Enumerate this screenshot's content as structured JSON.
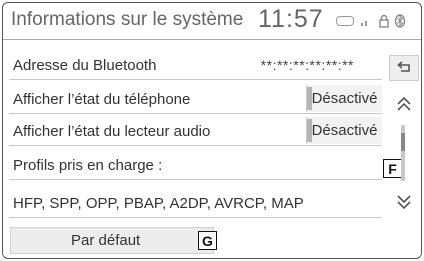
{
  "header": {
    "title": "Informations sur le système",
    "clock": "11:57",
    "status_icons": [
      "dcm-icon",
      "signal-icon",
      "lock-icon",
      "bluetooth-icon"
    ]
  },
  "rows": [
    {
      "label": "Adresse du Bluetooth",
      "value": "**:**:**:**:**:**"
    },
    {
      "label": "Afficher l’état du téléphone",
      "toggle": "Désactivé"
    },
    {
      "label": "Afficher l’état du lecteur audio",
      "toggle": "Désactivé"
    },
    {
      "label": "Profils pris en charge :"
    },
    {
      "label": "HFP, SPP, OPP, PBAP, A2DP, AVRCP, MAP"
    }
  ],
  "default_button": {
    "label": "Par défaut"
  },
  "callouts": {
    "f": "F",
    "g": "G"
  },
  "side": {
    "back_icon": "back-arrow-icon",
    "up_icon": "double-chevron-up-icon",
    "down_icon": "double-chevron-down-icon"
  }
}
